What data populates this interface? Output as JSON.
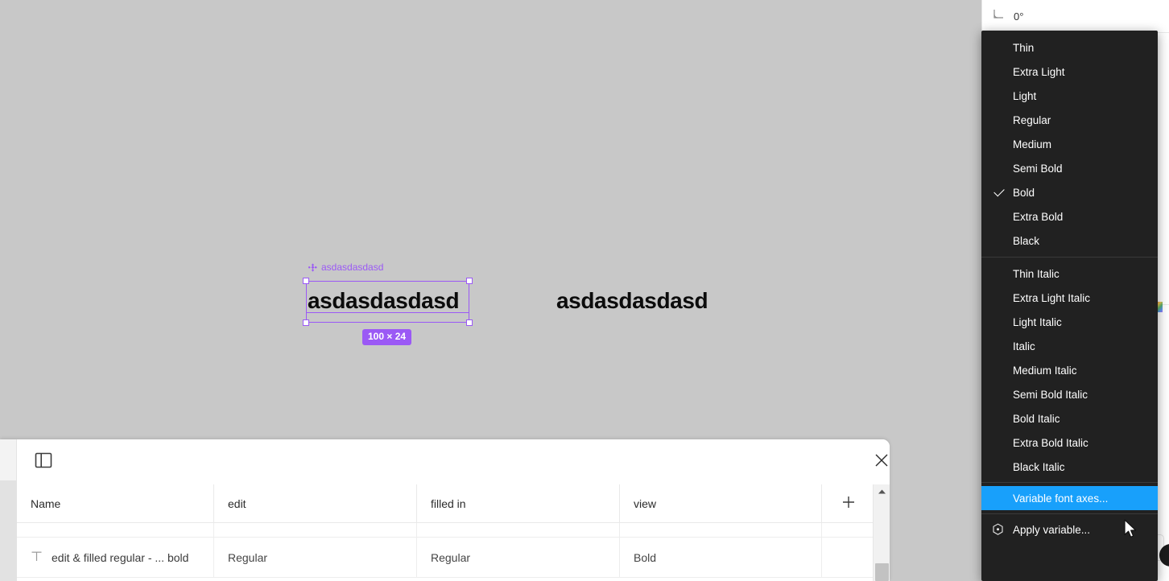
{
  "canvas": {
    "background_color": "#c8c8c8",
    "selection": {
      "accent_color": "#9b59f5",
      "component_label": "asdasdasdasd",
      "component_icon": "diamond-component-icon",
      "text_value": "asdasdasdasd",
      "dimension_badge": "100 × 24"
    },
    "reference_text": "asdasdasdasd"
  },
  "bottom_panel": {
    "panel_toggle_icon": "panel-layout-icon",
    "close_icon": "close-x-icon",
    "add_column_icon": "plus-icon",
    "scrollbar": {
      "up_arrow_icon": "caret-up-icon"
    },
    "table": {
      "columns": [
        "Name",
        "edit",
        "filled in",
        "view"
      ],
      "rows": [
        {
          "icon": "text-type-icon",
          "name": "edit & filled regular - ... bold",
          "edit": "Regular",
          "filled_in": "Regular",
          "view": "Bold"
        }
      ]
    }
  },
  "right_sidebar": {
    "rotation": {
      "icon": "angle-rotation-icon",
      "value": "0°"
    }
  },
  "font_style_menu": {
    "highlight_color": "#18a0fb",
    "background_color": "#212121",
    "checked_item": "Bold",
    "groups": [
      {
        "items": [
          {
            "label": "Thin",
            "checked": false
          },
          {
            "label": "Extra Light",
            "checked": false
          },
          {
            "label": "Light",
            "checked": false
          },
          {
            "label": "Regular",
            "checked": false
          },
          {
            "label": "Medium",
            "checked": false
          },
          {
            "label": "Semi Bold",
            "checked": false
          },
          {
            "label": "Bold",
            "checked": true
          },
          {
            "label": "Extra Bold",
            "checked": false
          },
          {
            "label": "Black",
            "checked": false
          }
        ]
      },
      {
        "items": [
          {
            "label": "Thin Italic",
            "checked": false
          },
          {
            "label": "Extra Light Italic",
            "checked": false
          },
          {
            "label": "Light Italic",
            "checked": false
          },
          {
            "label": "Italic",
            "checked": false
          },
          {
            "label": "Medium Italic",
            "checked": false
          },
          {
            "label": "Semi Bold Italic",
            "checked": false
          },
          {
            "label": "Bold Italic",
            "checked": false
          },
          {
            "label": "Extra Bold Italic",
            "checked": false
          },
          {
            "label": "Black Italic",
            "checked": false
          }
        ]
      }
    ],
    "variable_axes_item": {
      "label": "Variable font axes...",
      "highlighted": true
    },
    "apply_variable_item": {
      "label": "Apply variable...",
      "icon": "variable-hex-icon"
    }
  },
  "cursor": {
    "icon": "arrow-pointer-cursor"
  }
}
